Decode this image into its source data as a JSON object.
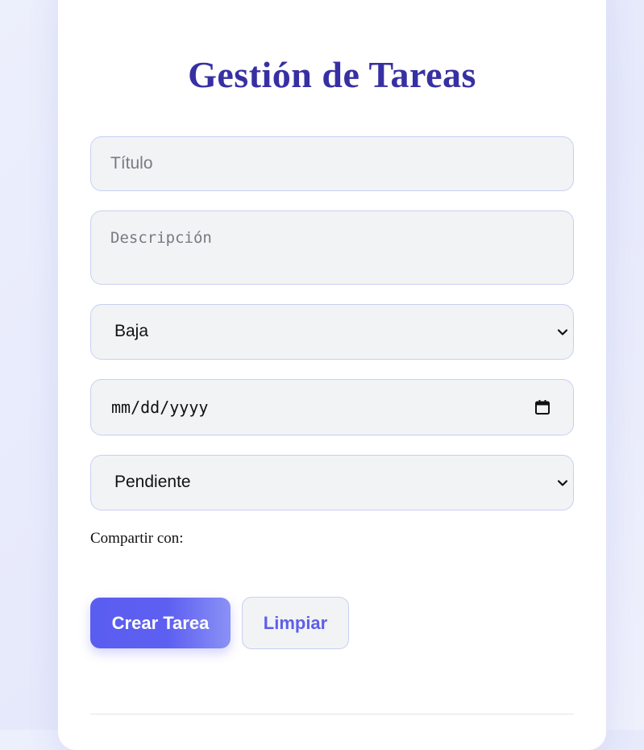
{
  "page": {
    "title": "Gestión de Tareas"
  },
  "form": {
    "title_placeholder": "Título",
    "description_placeholder": "Descripción",
    "priority_selected": "Baja",
    "due_date_placeholder": "mm/dd/yyyy",
    "status_selected": "Pendiente",
    "share_label": "Compartir con:"
  },
  "actions": {
    "create_label": "Crear Tarea",
    "clear_label": "Limpiar"
  },
  "icons": {
    "select_chevron": "chevron-down-icon",
    "date_picker": "calendar-icon"
  },
  "colors": {
    "title": "#3730a3",
    "primary_button_start": "#5a5ef0",
    "primary_button_end": "#8a91f5",
    "secondary_button_text": "#5d5fe8",
    "field_background": "#f2f3f5",
    "field_border": "#c9cff4"
  }
}
